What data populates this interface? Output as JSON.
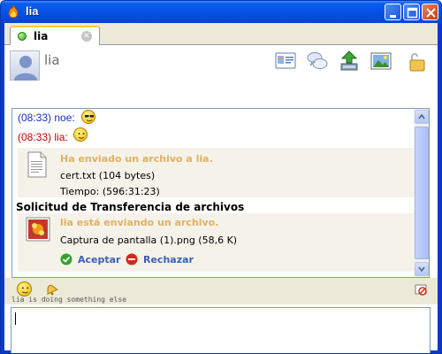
{
  "window": {
    "title": "lia"
  },
  "tab": {
    "label": "lia"
  },
  "header": {
    "contact_name": "lia"
  },
  "toolbar": {
    "icons": [
      "contact-card-icon",
      "conversation-icon",
      "send-file-icon",
      "picture-icon",
      "lock-icon"
    ]
  },
  "messages": [
    {
      "time": "(08:33)",
      "sender": "noe:",
      "color": "#1a2fc0",
      "emoticon": "cool-smiley"
    },
    {
      "time": "(08:33)",
      "sender": "lia:",
      "color": "#c80000",
      "emoticon": "smiley"
    }
  ],
  "file_sent": {
    "heading": "Ha enviado un archivo a lia.",
    "filename": "cert.txt (104 bytes)",
    "time_label": "Tiempo: (596:31:23)"
  },
  "transfer_request": {
    "title": "Solicitud de Transferencia de archivos",
    "heading": "lia está enviando un archivo.",
    "filename": "Captura de pantalla (1).png (58,6 K)",
    "accept_label": "Aceptar",
    "reject_label": "Rechazar"
  },
  "status": {
    "text": "lia is doing something else"
  },
  "input": {
    "value": ""
  }
}
